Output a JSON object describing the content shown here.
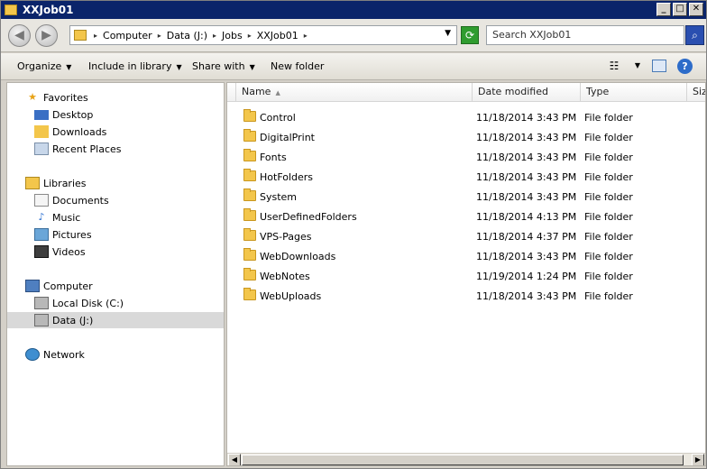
{
  "window": {
    "title": "XXJob01"
  },
  "address": {
    "segments": [
      "Computer",
      "Data (J:)",
      "Jobs",
      "XXJob01"
    ],
    "search_placeholder": "Search XXJob01"
  },
  "toolbar": {
    "organize": "Organize",
    "include_in_library": "Include in library",
    "share_with": "Share with",
    "new_folder": "New folder"
  },
  "nav": {
    "favorites": "Favorites",
    "desktop": "Desktop",
    "downloads": "Downloads",
    "recent_places": "Recent Places",
    "libraries": "Libraries",
    "documents": "Documents",
    "music": "Music",
    "pictures": "Pictures",
    "videos": "Videos",
    "computer": "Computer",
    "local_disk": "Local Disk (C:)",
    "data_j": "Data (J:)",
    "network": "Network"
  },
  "columns": {
    "name": "Name",
    "date_modified": "Date modified",
    "type": "Type",
    "size": "Size"
  },
  "files": [
    {
      "name": "Control",
      "date": "11/18/2014 3:43 PM",
      "type": "File folder"
    },
    {
      "name": "DigitalPrint",
      "date": "11/18/2014 3:43 PM",
      "type": "File folder"
    },
    {
      "name": "Fonts",
      "date": "11/18/2014 3:43 PM",
      "type": "File folder"
    },
    {
      "name": "HotFolders",
      "date": "11/18/2014 3:43 PM",
      "type": "File folder"
    },
    {
      "name": "System",
      "date": "11/18/2014 3:43 PM",
      "type": "File folder"
    },
    {
      "name": "UserDefinedFolders",
      "date": "11/18/2014 4:13 PM",
      "type": "File folder"
    },
    {
      "name": "VPS-Pages",
      "date": "11/18/2014 4:37 PM",
      "type": "File folder"
    },
    {
      "name": "WebDownloads",
      "date": "11/18/2014 3:43 PM",
      "type": "File folder"
    },
    {
      "name": "WebNotes",
      "date": "11/19/2014 1:24 PM",
      "type": "File folder"
    },
    {
      "name": "WebUploads",
      "date": "11/18/2014 3:43 PM",
      "type": "File folder"
    }
  ]
}
